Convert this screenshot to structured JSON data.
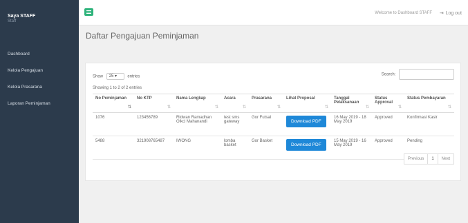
{
  "sidebar": {
    "brand_title": "Saya STAFF",
    "brand_sub": "Staff",
    "items": [
      {
        "label": "Dashboard"
      },
      {
        "label": "Kelola Pengajuan"
      },
      {
        "label": "Kelola Prasarana"
      },
      {
        "label": "Laporan Peminjaman"
      }
    ]
  },
  "topbar": {
    "welcome": "Welcome to Dashboard STAFF",
    "logout": "Log out",
    "logout_icon": "sign-out-icon",
    "menu_icon": "hamburger-icon"
  },
  "page": {
    "title": "Daftar Pengajuan Peminjaman"
  },
  "table_controls": {
    "show": "Show",
    "entries_value": "25",
    "entries": "entries",
    "search_label": "Search:",
    "search_value": "",
    "showing": "Showing 1 to 2 of 2 entries"
  },
  "table": {
    "headers": [
      "No Peminjaman",
      "No KTP",
      "Nama Lengkap",
      "Acara",
      "Prasarana",
      "Lihat Proposal",
      "Tanggal Pelaksanaan",
      "Status Approval",
      "Status Pembayaran"
    ],
    "rows": [
      {
        "no": "1076",
        "ktp": "123456789",
        "nama": "Ridwan Ramadhan Olkci Mahanandi",
        "acara": "test sms gateway",
        "prasarana": "Gor Futsal",
        "proposal": "Download PDF",
        "tanggal": "16 May 2019 - 18 May 2019",
        "approval": "Approved",
        "pembayaran": "Konfirmasi Kasir"
      },
      {
        "no": "5488",
        "ktp": "321908765487",
        "nama": "IWONG",
        "acara": "lomba basket",
        "prasarana": "Gor Basket",
        "proposal": "Download PDF",
        "tanggal": "15 May 2019 - 16 May 2019",
        "approval": "Approved",
        "pembayaran": "Pending"
      }
    ]
  },
  "pagination": {
    "previous": "Previous",
    "current": "1",
    "next": "Next"
  },
  "colors": {
    "sidebar": "#2c3b4c",
    "accent_green": "#2eb37b",
    "button_blue": "#1e88d8"
  }
}
